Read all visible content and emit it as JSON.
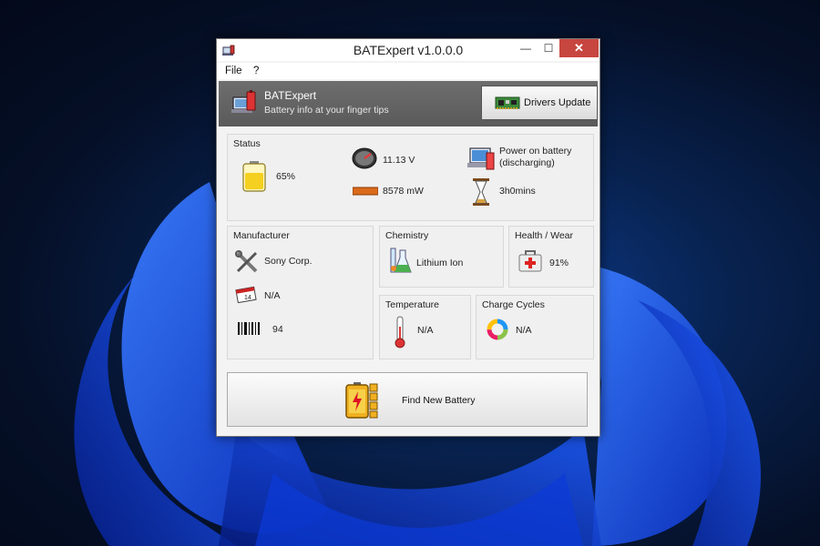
{
  "window": {
    "title": "BATExpert v1.0.0.0",
    "close_glyph": "✕",
    "min_glyph": "—",
    "max_glyph": "☐"
  },
  "menu": {
    "file": "File",
    "help": "?"
  },
  "banner": {
    "title": "BATExpert",
    "subtitle": "Battery info at your finger tips",
    "drivers_button": "Drivers Update"
  },
  "status": {
    "title": "Status",
    "charge": "65%",
    "voltage": "11.13 V",
    "power": "8578 mW",
    "power_state": "Power on battery",
    "power_state_detail": "(discharging)",
    "time_left": "3h0mins",
    "charge_level": 0.65
  },
  "manufacturer": {
    "title": "Manufacturer",
    "name": "Sony Corp.",
    "date": "N/A",
    "serial": "94"
  },
  "chemistry": {
    "title": "Chemistry",
    "value": "Lithium Ion"
  },
  "health": {
    "title": "Health / Wear",
    "value": "91%"
  },
  "temperature": {
    "title": "Temperature",
    "value": "N/A"
  },
  "cycles": {
    "title": "Charge Cycles",
    "value": "N/A"
  },
  "find_button": "Find New Battery",
  "colors": {
    "accent_close": "#c7463f",
    "banner": "#606060",
    "battery_fill": "#f5d020"
  },
  "icons": {
    "app": "battery-laptop-icon",
    "drivers": "circuit-board-icon",
    "battery": "battery-icon",
    "gauge": "gauge-icon",
    "power": "power-bar-icon",
    "laptop": "laptop-icon",
    "hourglass": "hourglass-icon",
    "tools": "tools-icon",
    "calendar": "calendar-icon",
    "barcode": "barcode-icon",
    "flask": "flask-icon",
    "medkit": "medkit-icon",
    "thermometer": "thermometer-icon",
    "cycles": "cycle-ring-icon",
    "find_battery": "battery-stack-icon"
  }
}
